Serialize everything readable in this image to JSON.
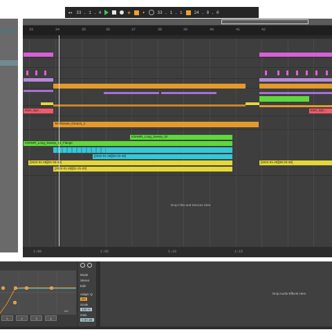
{
  "transport": {
    "position": "33 . 1 . 4",
    "loop_start": "33 . 1 . 1",
    "loop_length": "24 . 0 . 0",
    "play_color": "#3ec84f",
    "accent_color": "#f0a030"
  },
  "ruler": {
    "bars": [
      "33",
      "34",
      "35",
      "36",
      "37",
      "38",
      "39",
      "40",
      "41",
      "42"
    ]
  },
  "time_ruler": [
    "1:00",
    "1:05",
    "1:10",
    "1:15"
  ],
  "clips": {
    "techhouse": "Techhouse_Gruoo1_1",
    "ksh_sweep_1": "KSHMR_Long_Sweep_14_Flange",
    "ksh_sweep_2": "KSHMR_Long_Sweep_02",
    "ksh_right": "KSH_Syn...",
    "ksh_left": "KSH_Syn...",
    "date_1": "[2022-01-25][01-33-40]",
    "date_2": "[2022-01-28][01-31-20]",
    "date_3": "[2022-01-28][00-32-48]",
    "date_4": "[2022-01-20][08-20-48]",
    "date_5": "[2022-01-26][15-20-48]"
  },
  "drop_files_label": "Drop Files and Devices Here",
  "device": {
    "mode_label": "Mode",
    "mode_value": "Stereo",
    "edit_label": "Edit",
    "adapt_label": "Adapt. Q",
    "adapt_value": "On",
    "scale_label": "Scale",
    "scale_value": "100 %",
    "gain_label": "Gain",
    "gain_value": "0.00 dB",
    "band_buttons": [
      "1",
      "2",
      "3",
      "4"
    ],
    "freq_label": "10k"
  },
  "fx_drop_label": "Drop Audio Effects Here"
}
